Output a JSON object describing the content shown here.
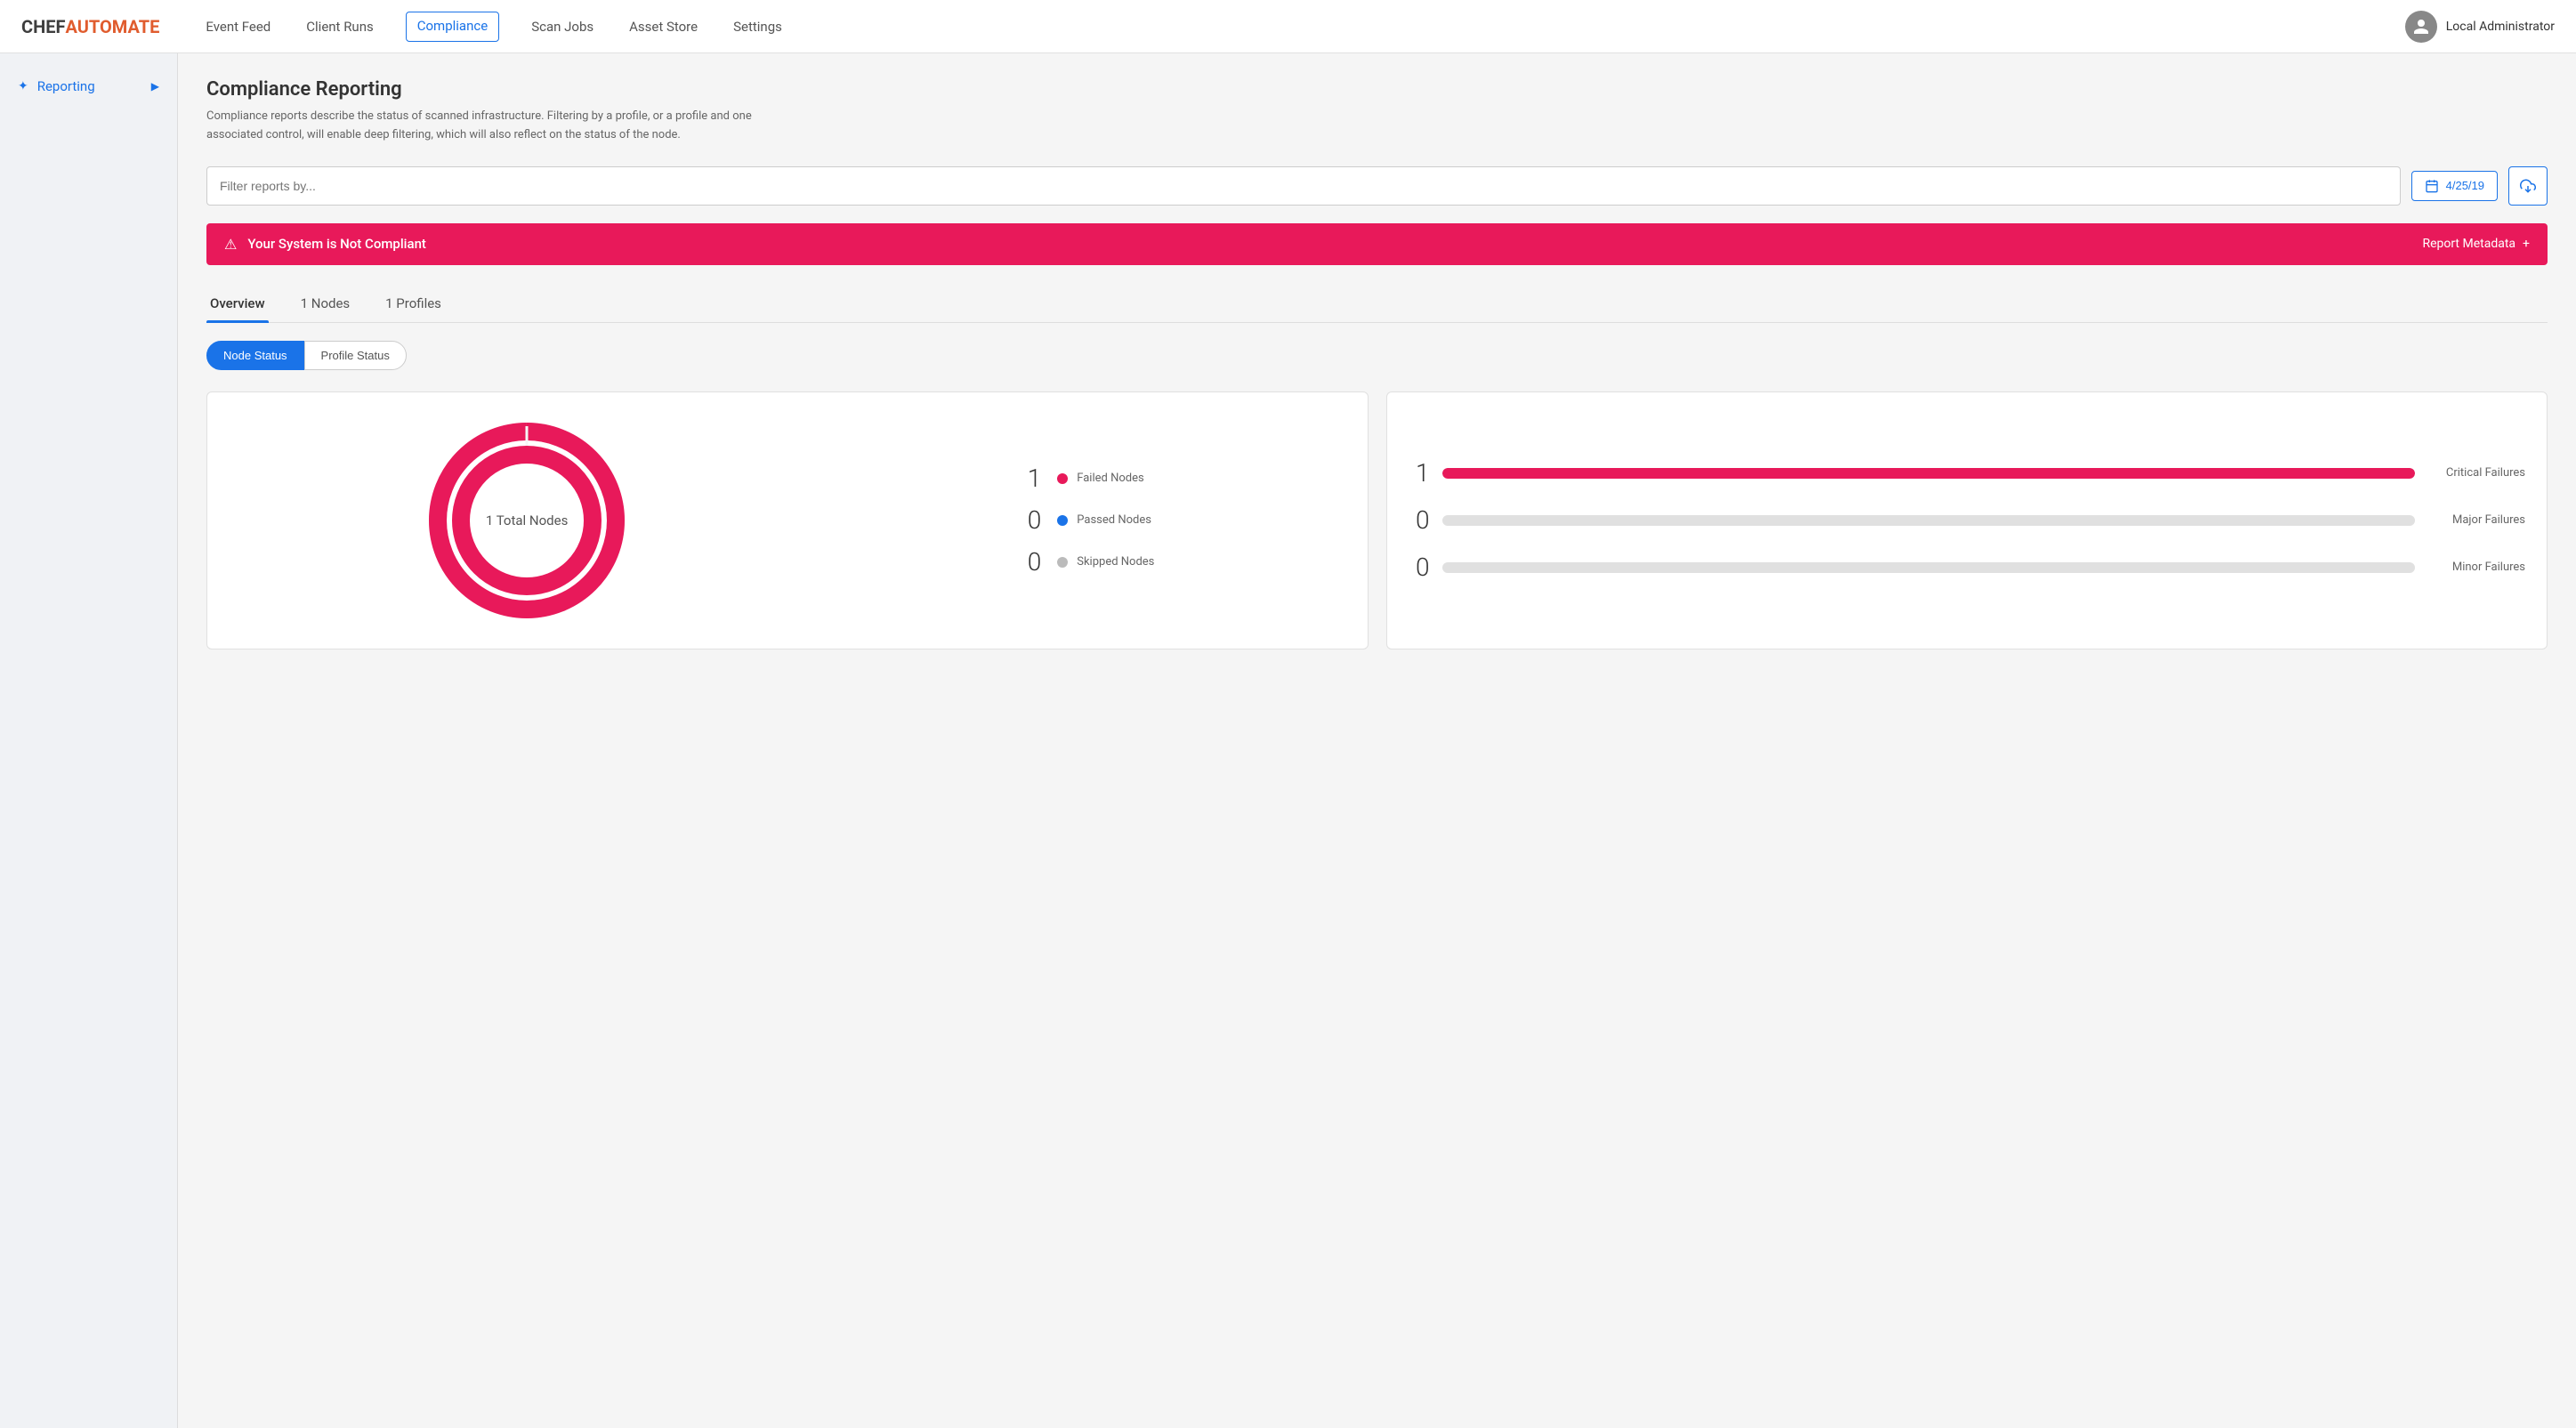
{
  "app": {
    "logo_chef": "CHEF",
    "logo_automate": "AUTOMATE"
  },
  "nav": {
    "links": [
      {
        "label": "Event Feed",
        "active": false
      },
      {
        "label": "Client Runs",
        "active": false
      },
      {
        "label": "Compliance",
        "active": true
      },
      {
        "label": "Scan Jobs",
        "active": false
      },
      {
        "label": "Asset Store",
        "active": false
      },
      {
        "label": "Settings",
        "active": false
      }
    ],
    "user_name": "Local Administrator"
  },
  "sidebar": {
    "item_label": "Reporting",
    "arrow": "▶"
  },
  "main": {
    "page_title": "Compliance Reporting",
    "page_desc": "Compliance reports describe the status of scanned infrastructure. Filtering by a profile, or a profile and one associated control, will enable deep filtering, which will also reflect on the status of the node.",
    "filter_placeholder": "Filter reports by...",
    "date_label": "4/25/19",
    "status_banner": {
      "icon": "⚠",
      "message": "Your System is Not Compliant",
      "metadata_label": "Report Metadata",
      "plus": "+"
    },
    "tabs": [
      {
        "label": "Overview",
        "active": true
      },
      {
        "label": "1 Nodes",
        "active": false
      },
      {
        "label": "1 Profiles",
        "active": false
      }
    ],
    "toggle": {
      "node_status": "Node Status",
      "profile_status": "Profile Status"
    },
    "donut": {
      "center_label": "1 Total Nodes",
      "legend": [
        {
          "count": "1",
          "label": "Failed Nodes",
          "color": "#e8195a"
        },
        {
          "count": "0",
          "label": "Passed Nodes",
          "color": "#1a73e8"
        },
        {
          "count": "0",
          "label": "Skipped Nodes",
          "color": "#bbb"
        }
      ]
    },
    "bars": [
      {
        "count": "1",
        "label": "Critical Failures",
        "fill_pct": 100
      },
      {
        "count": "0",
        "label": "Major Failures",
        "fill_pct": 0
      },
      {
        "count": "0",
        "label": "Minor Failures",
        "fill_pct": 0
      }
    ]
  },
  "colors": {
    "accent": "#e8195a",
    "blue": "#1a73e8",
    "passed": "#1a73e8",
    "skipped": "#bbb"
  }
}
